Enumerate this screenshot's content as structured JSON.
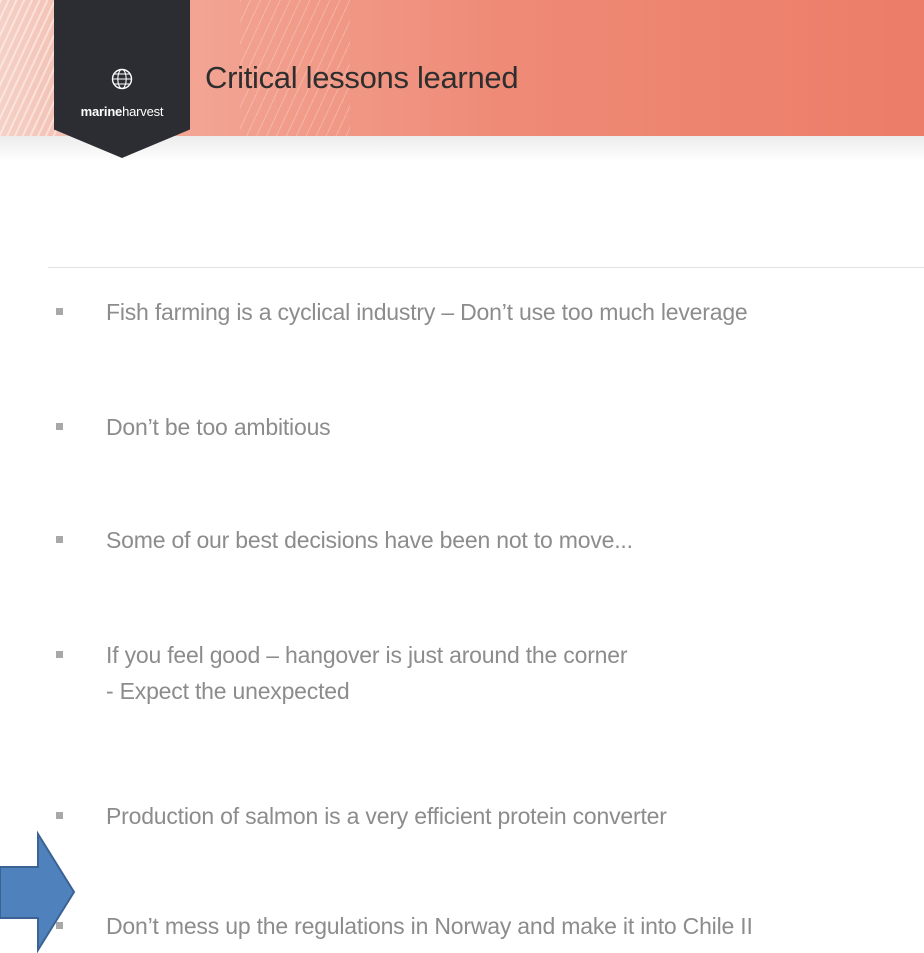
{
  "header": {
    "logo_text_bold": "marine",
    "logo_text_regular": "harvest",
    "title": "Critical lessons learned"
  },
  "bullets": [
    {
      "text": "Fish farming is a cyclical industry – Don’t use too much leverage"
    },
    {
      "text": "Don’t be too ambitious"
    },
    {
      "text": "Some of our best decisions have been not to move..."
    },
    {
      "text": "If you feel good – hangover is just around the corner",
      "sub": "- Expect the unexpected"
    },
    {
      "text": "Production of salmon is a very efficient protein converter"
    },
    {
      "text": "Don’t mess up the regulations in Norway and make it into Chile II"
    }
  ],
  "colors": {
    "header_accent": "#ec7d68",
    "logo_badge": "#2b2d33",
    "arrow": "#4f81bd"
  },
  "icons": {
    "logo": "globe-icon",
    "pointer": "right-arrow-icon"
  }
}
